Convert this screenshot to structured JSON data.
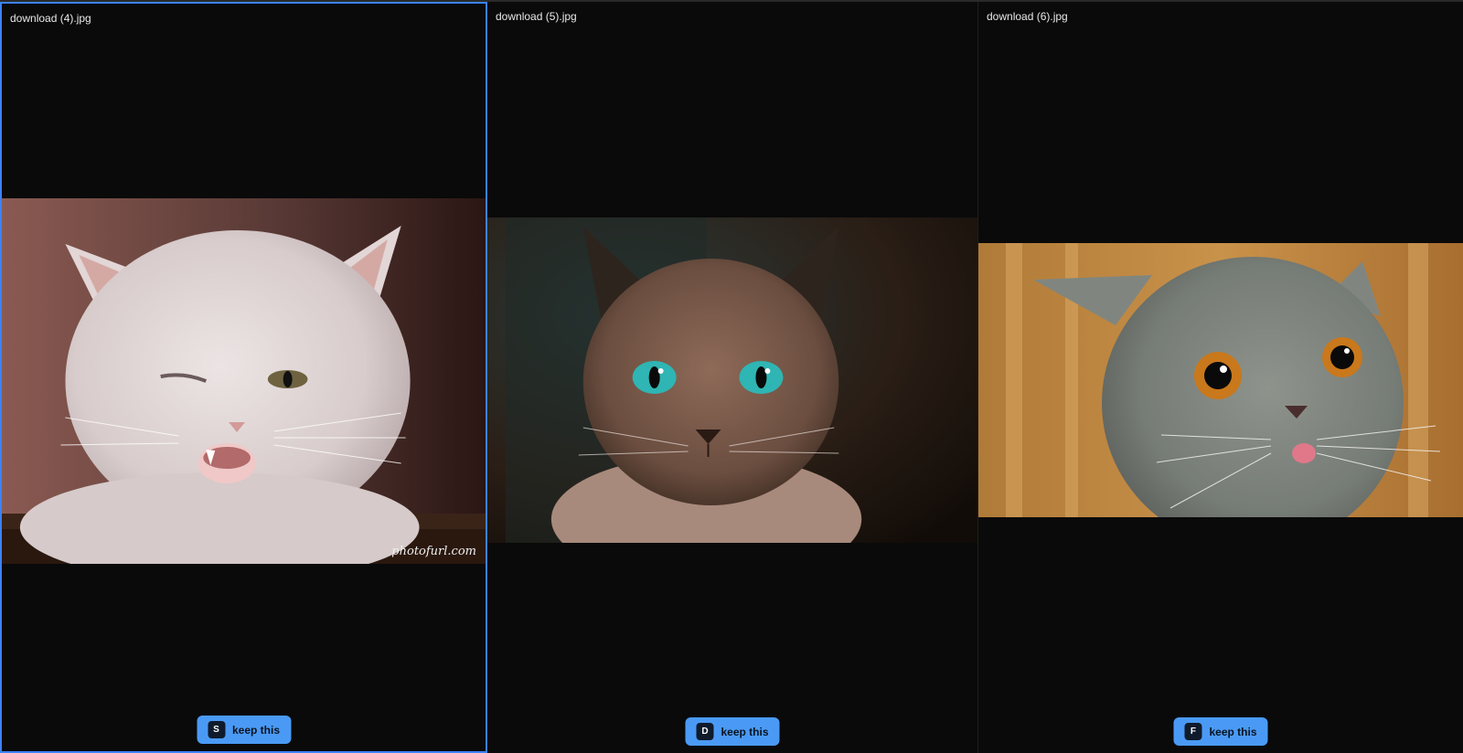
{
  "panels": [
    {
      "filename": "download (4).jpg",
      "selected": true,
      "watermark": "photofurl.com",
      "shortcut": "S",
      "button_label": "keep this",
      "image": "white-kitten-winking"
    },
    {
      "filename": "download (5).jpg",
      "selected": false,
      "shortcut": "D",
      "button_label": "keep this",
      "image": "siamese-cat-teal-eyes"
    },
    {
      "filename": "download (6).jpg",
      "selected": false,
      "shortcut": "F",
      "button_label": "keep this",
      "image": "grey-cat-tongue-out"
    }
  ],
  "colors": {
    "background": "#0b0b0b",
    "accent": "#4a9af5",
    "selected_border": "#3b82f6"
  }
}
